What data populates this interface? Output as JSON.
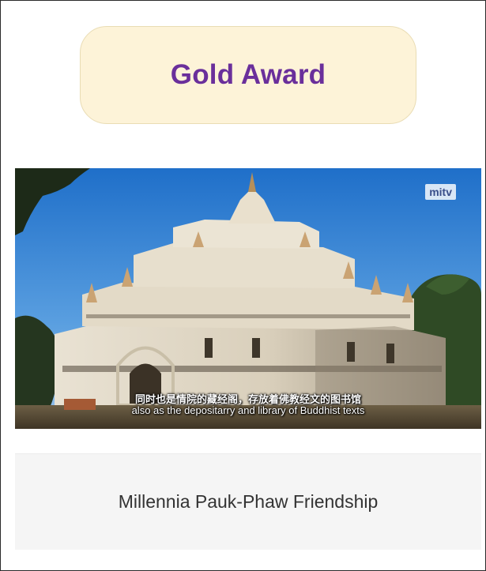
{
  "award": {
    "title": "Gold Award",
    "title_color": "#6a2f9b",
    "badge_color": "#fdf3d8"
  },
  "photo": {
    "watermark": "mitv",
    "subtitle_cn": "同时也是情院的藏经阁，存放着佛教经文的图书馆",
    "subtitle_en": "also as the depositarry and library of Buddhist texts",
    "sky_color": "#2f7ed0"
  },
  "caption": {
    "text": "Millennia Pauk-Phaw Friendship"
  }
}
